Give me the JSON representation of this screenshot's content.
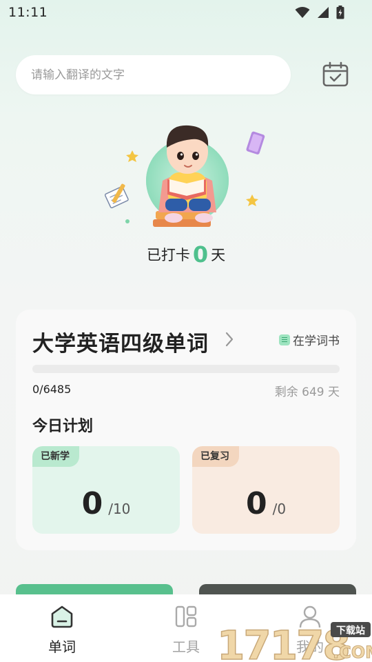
{
  "status_bar": {
    "time": "11:11",
    "icons": [
      "wifi-icon",
      "signal-icon",
      "battery-icon"
    ]
  },
  "search": {
    "placeholder": "请输入翻译的文字",
    "value": ""
  },
  "header": {
    "calendar_icon": "calendar-check-icon"
  },
  "checkin": {
    "prefix": "已打卡",
    "days": "0",
    "suffix": "天"
  },
  "book": {
    "title": "大学英语四级单词",
    "tag_label": "在学词书",
    "progress_text": "0/6485",
    "progress_fraction": 0,
    "remaining_text": "剩余 649 天"
  },
  "plan": {
    "title": "今日计划",
    "new": {
      "badge": "已新学",
      "done": "0",
      "total": "/10"
    },
    "review": {
      "badge": "已复习",
      "done": "0",
      "total": "/0"
    }
  },
  "tabs": [
    {
      "label": "单词",
      "icon": "home-icon",
      "active": true
    },
    {
      "label": "工具",
      "icon": "grid-icon",
      "active": false
    },
    {
      "label": "我的",
      "icon": "user-icon",
      "active": false
    }
  ],
  "watermark": {
    "text": "17178",
    "sub": "下载站",
    "domain": ".COM"
  },
  "colors": {
    "accent": "#4fc08d",
    "review_bg": "#f9ebe1",
    "new_bg": "#e3f5ec"
  }
}
